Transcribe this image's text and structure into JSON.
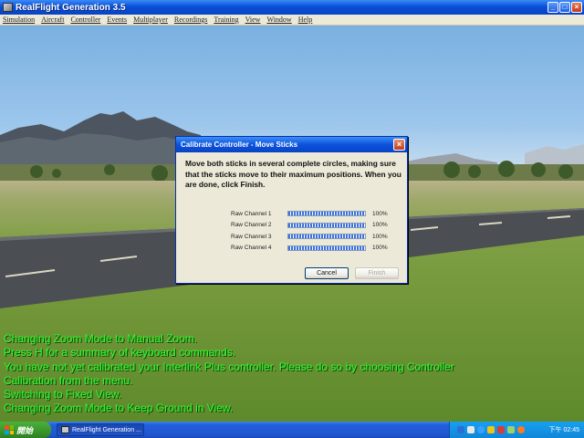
{
  "window": {
    "title": "RealFlight Generation 3.5",
    "buttons": {
      "minimize": "_",
      "maximize": "□",
      "close": "×"
    }
  },
  "menu": [
    "Simulation",
    "Aircraft",
    "Controller",
    "Events",
    "Multiplayer",
    "Recordings",
    "Training",
    "View",
    "Window",
    "Help"
  ],
  "dialog": {
    "title": "Calibrate Controller - Move Sticks",
    "message": "Move both sticks in several complete circles, making sure that the sticks move to their maximum positions.  When you are done, click Finish.",
    "channels": [
      {
        "label": "Raw Channel 1",
        "percent": "100%",
        "level": 1.0
      },
      {
        "label": "Raw Channel 2",
        "percent": "100%",
        "level": 1.0
      },
      {
        "label": "Raw Channel 3",
        "percent": "100%",
        "level": 1.0
      },
      {
        "label": "Raw Channel 4",
        "percent": "100%",
        "level": 1.0
      }
    ],
    "cancel_label": "Cancel",
    "finish_label": "Finish"
  },
  "log": [
    "Changing Zoom Mode to Manual Zoom.",
    "Press H for a summary of keyboard commands.",
    "You have not yet calibrated your Interlink Plus controller.  Please do so by choosing Controller",
    "Calibration from the menu.",
    "Switching to Fixed View.",
    "Changing Zoom Mode to Keep Ground in View."
  ],
  "taskbar": {
    "start_label": "開始",
    "task_label": "RealFlight Generation ...",
    "clock": "下午 02:45"
  },
  "colors": {
    "log_text": "#2cff2c",
    "title_blue": "#0a4fd8",
    "dialog_bg": "#ece9d8"
  }
}
